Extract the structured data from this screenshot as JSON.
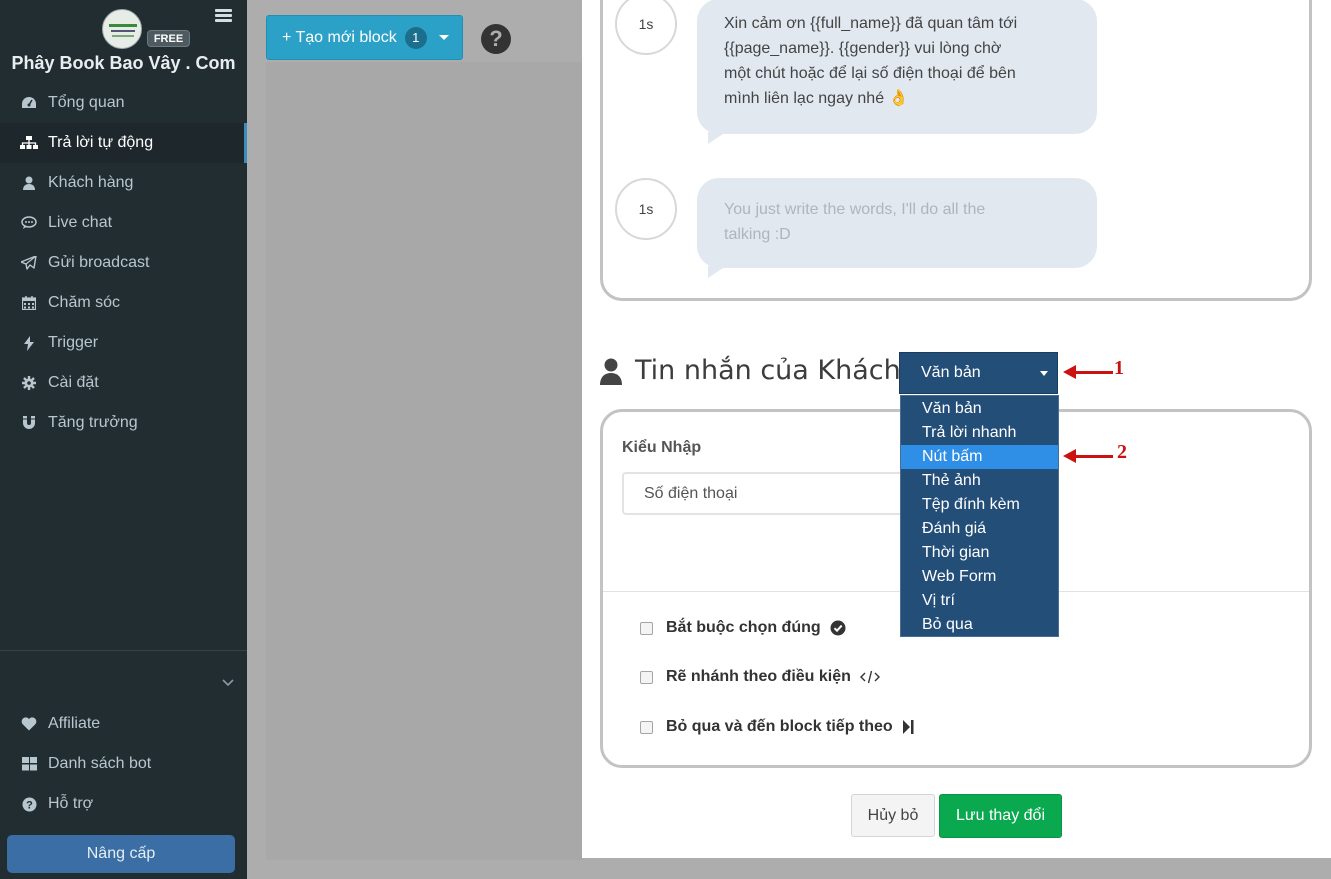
{
  "sidebar": {
    "free_badge": "FREE",
    "brand": "Phây Book Bao Vây . Com",
    "items": [
      {
        "label": "Tổng quan",
        "icon": "dashboard-icon"
      },
      {
        "label": "Trả lời tự động",
        "icon": "sitemap-icon",
        "active": true
      },
      {
        "label": "Khách hàng",
        "icon": "user-icon"
      },
      {
        "label": "Live chat",
        "icon": "chat-icon"
      },
      {
        "label": "Gửi broadcast",
        "icon": "paper-plane-icon"
      },
      {
        "label": "Chăm sóc",
        "icon": "calendar-icon"
      },
      {
        "label": "Trigger",
        "icon": "bolt-icon"
      },
      {
        "label": "Cài đặt",
        "icon": "gear-icon"
      },
      {
        "label": "Tăng trưởng",
        "icon": "magnet-icon"
      }
    ],
    "bottom_items": [
      {
        "label": "Affiliate",
        "icon": "heart-icon"
      },
      {
        "label": "Danh sách bot",
        "icon": "grid-icon"
      },
      {
        "label": "Hỗ trợ",
        "icon": "question-circle-icon"
      }
    ],
    "upgrade_label": "Nâng cấp"
  },
  "toolbar": {
    "create_label": "+ Tạo mới block",
    "create_count": "1"
  },
  "bot_messages": [
    {
      "delay": "1s",
      "lines": [
        "Xin cảm ơn {{full_name}} đã quan tâm tới",
        "{{page_name}}. {{gender}} vui lòng chờ",
        "một chút hoặc để lại số điện thoại để bên",
        "mình liên lạc ngay nhé 👌"
      ]
    },
    {
      "delay": "1s",
      "lines": [
        "You just write the words, I'll do all the",
        "talking :D"
      ]
    }
  ],
  "user_section": {
    "title": "Tin nhắn của Khách",
    "selected_type": "Văn bản",
    "dropdown_options": [
      "Văn bản",
      "Trả lời nhanh",
      "Nút bấm",
      "Thẻ ảnh",
      "Tệp đính kèm",
      "Đánh giá",
      "Thời gian",
      "Web Form",
      "Vị trí",
      "Bỏ qua"
    ],
    "highlighted_option": "Nút bấm",
    "input_type_label": "Kiểu Nhập",
    "input_type_value": "Số điện thoại",
    "options": [
      {
        "label": "Bắt buộc chọn đúng",
        "icon": "check-circle-icon"
      },
      {
        "label": "Rẽ nhánh theo điều kiện",
        "icon": "code-icon"
      },
      {
        "label": "Bỏ qua và đến block tiếp theo",
        "icon": "step-forward-icon"
      }
    ]
  },
  "annotations": [
    "1",
    "2"
  ],
  "actions": {
    "cancel_label": "Hủy bỏ",
    "save_label": "Lưu thay đổi"
  },
  "colors": {
    "sidebar_bg": "#222d32",
    "create_button": "#2ba1c7",
    "select_bg": "#234e78",
    "highlight": "#2f8fe7",
    "save_button": "#0aa84f",
    "annotation": "#cc1111"
  }
}
